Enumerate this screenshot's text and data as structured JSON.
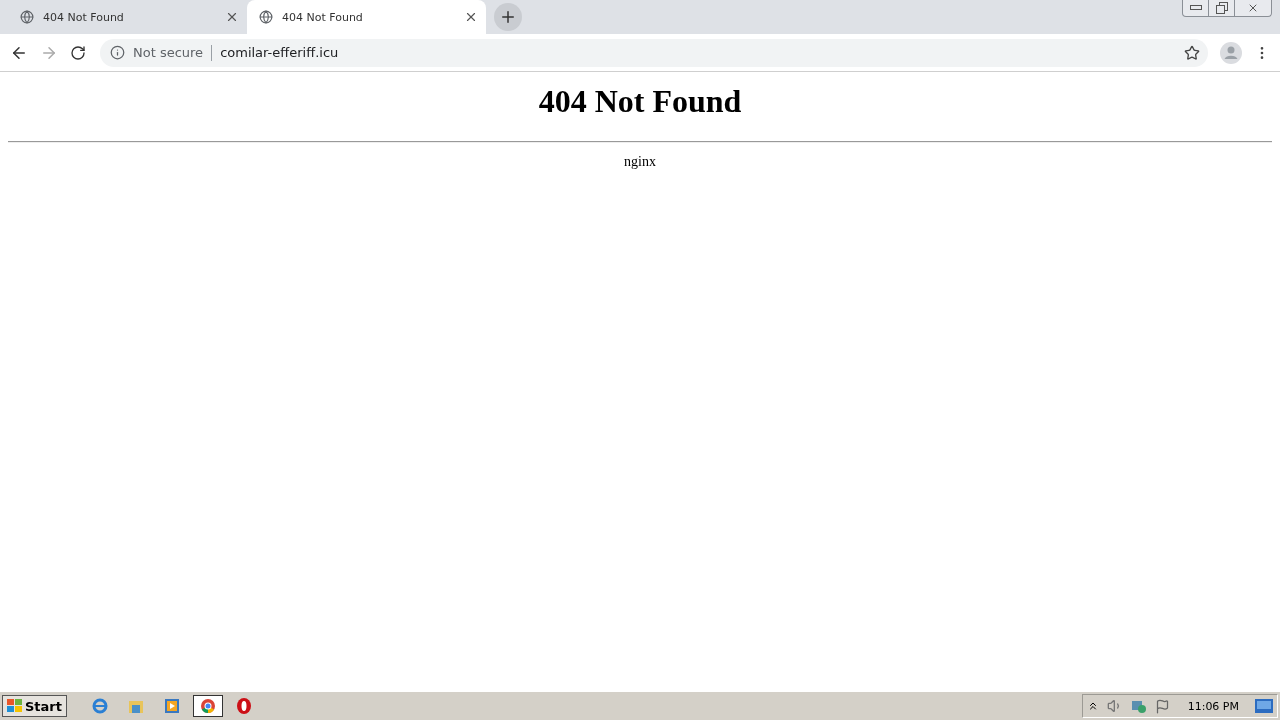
{
  "tabs": [
    {
      "title": "404 Not Found",
      "selected": false
    },
    {
      "title": "404 Not Found",
      "selected": true
    }
  ],
  "address_bar": {
    "security": "Not secure",
    "url": "comilar-efferiff.icu"
  },
  "page": {
    "heading": "404 Not Found",
    "footer": "nginx"
  },
  "taskbar": {
    "start": "Start",
    "apps": [
      {
        "kind": "ie",
        "selected": false
      },
      {
        "kind": "folder",
        "selected": false
      },
      {
        "kind": "media",
        "selected": false
      },
      {
        "kind": "chrome",
        "selected": true
      },
      {
        "kind": "opera",
        "selected": false
      }
    ],
    "clock": "11:06 PM"
  }
}
